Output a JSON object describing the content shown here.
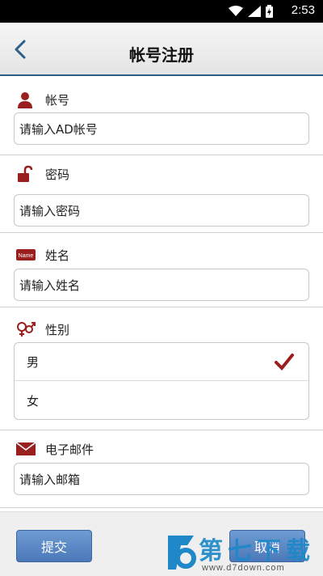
{
  "status_bar": {
    "time": "2:53"
  },
  "header": {
    "title": "帐号注册"
  },
  "form": {
    "account": {
      "label": "帐号",
      "placeholder": "请输入AD帐号"
    },
    "password": {
      "label": "密码",
      "placeholder": "请输入密码"
    },
    "name": {
      "label": "姓名",
      "placeholder": "请输入姓名",
      "icon_text": "Name"
    },
    "gender": {
      "label": "性别",
      "options": [
        "男",
        "女"
      ],
      "selected": "男"
    },
    "email": {
      "label": "电子邮件",
      "placeholder": "请输入邮箱"
    }
  },
  "buttons": {
    "submit": "提交",
    "cancel": "取消"
  },
  "watermark": {
    "text": "第七下载",
    "url": "www.d7down.com"
  },
  "colors": {
    "icon_red": "#9a1f1f",
    "header_border": "#2b5f8a",
    "button_blue": "#5a86c2",
    "watermark_blue": "#1e88c8"
  }
}
